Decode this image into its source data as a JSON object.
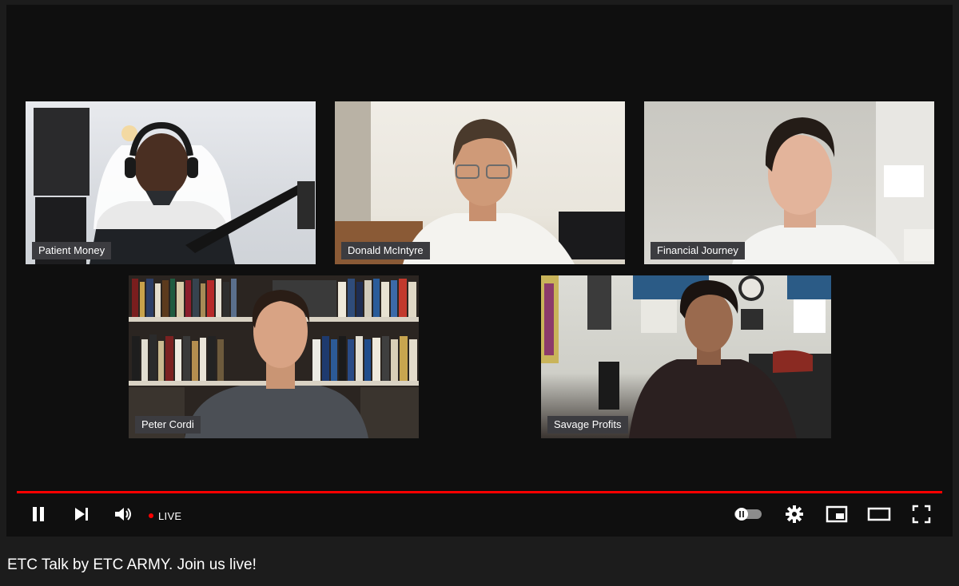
{
  "participants": [
    {
      "name": "Patient Money"
    },
    {
      "name": "Donald McIntyre"
    },
    {
      "name": "Financial Journey"
    },
    {
      "name": "Peter Cordi"
    },
    {
      "name": "Savage Profits"
    }
  ],
  "player": {
    "live_label": "LIVE",
    "accent_color": "#ff0000",
    "icons": [
      "pause-icon",
      "next-icon",
      "volume-icon",
      "autoplay-toggle-icon",
      "settings-gear-icon",
      "miniplayer-icon",
      "theater-mode-icon",
      "fullscreen-icon"
    ]
  },
  "video": {
    "title": "ETC Talk by ETC ARMY. Join us live!"
  }
}
